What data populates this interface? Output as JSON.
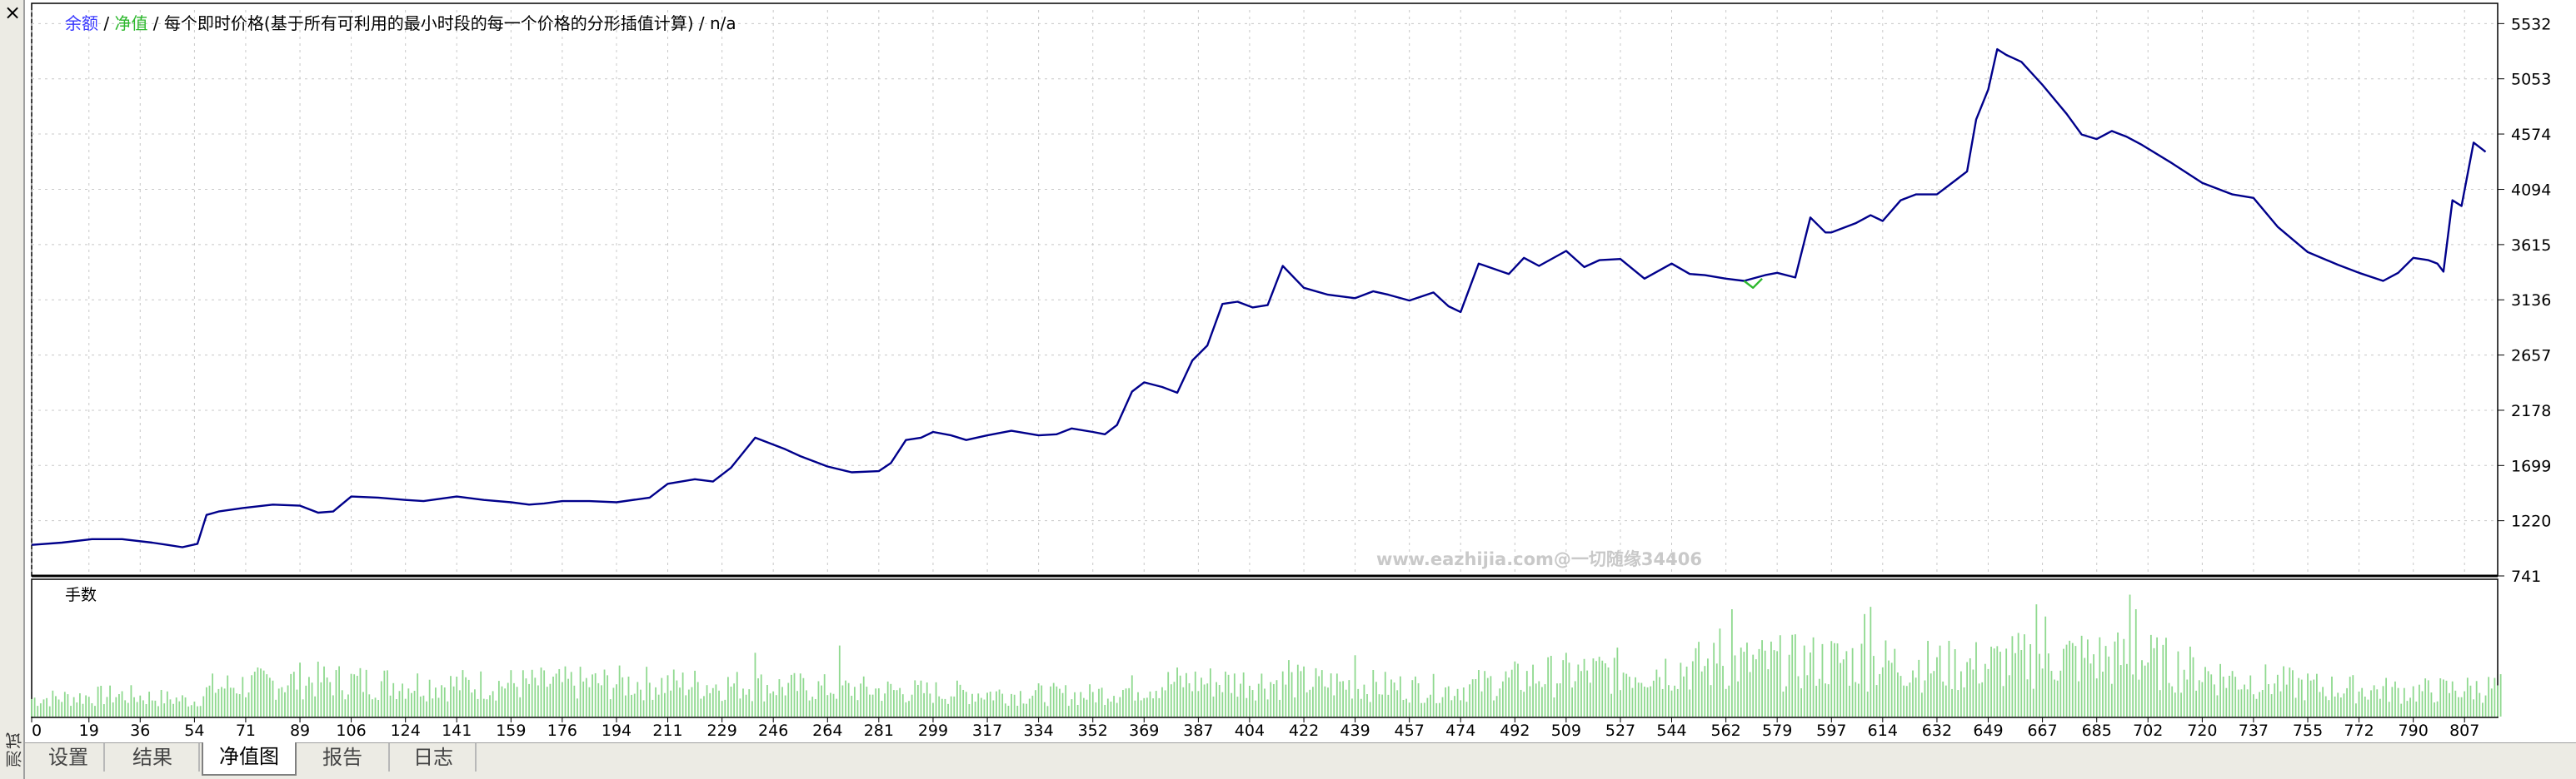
{
  "sidebar": {
    "close_label": "×",
    "label": "测试"
  },
  "legend": {
    "balance": "余额",
    "sep1": " / ",
    "equity": "净值",
    "sep2": " / ",
    "rest": "每个即时价格(基于所有可利用的最小时段的每一个价格的分形插值计算) / n/a"
  },
  "lower_panel_label": "手数",
  "watermark": "www.eazhijia.com@一切随缘34406",
  "tabs": [
    {
      "label": "设置",
      "active": false
    },
    {
      "label": "结果",
      "active": false
    },
    {
      "label": "净值图",
      "active": true
    },
    {
      "label": "报告",
      "active": false
    },
    {
      "label": "日志",
      "active": false
    }
  ],
  "colors": {
    "balance_line": "#00008b",
    "equity_line": "#2db82d",
    "volume_bars": "#8fd98f",
    "grid": "#c8c8c8",
    "axis": "#000000"
  },
  "chart_data": [
    {
      "type": "line",
      "series": [
        {
          "name": "余额",
          "x": [
            0,
            10,
            20,
            30,
            40,
            45,
            50,
            55,
            58,
            62,
            70,
            80,
            89,
            95,
            100,
            106,
            115,
            124,
            130,
            141,
            150,
            159,
            165,
            170,
            176,
            185,
            194,
            205,
            211,
            220,
            226,
            232,
            240,
            250,
            255,
            264,
            272,
            281,
            285,
            290,
            295,
            299,
            305,
            310,
            317,
            325,
            334,
            340,
            345,
            352,
            356,
            360,
            365,
            369,
            375,
            380,
            385,
            390,
            395,
            400,
            405,
            410,
            415,
            422,
            430,
            439,
            445,
            450,
            457,
            465,
            470,
            474,
            480,
            490,
            495,
            500,
            509,
            515,
            520,
            527,
            535,
            544,
            550,
            555,
            562,
            568,
            575,
            579,
            585,
            590,
            595,
            597,
            605,
            610,
            614,
            620,
            625,
            632,
            638,
            642,
            645,
            649,
            652,
            655,
            660,
            667,
            675,
            680,
            685,
            690,
            695,
            700,
            710,
            720,
            730,
            737,
            745,
            755,
            765,
            772,
            780,
            785,
            790,
            795,
            798,
            800,
            803,
            806,
            810,
            814
          ],
          "values": [
            1010,
            1030,
            1060,
            1060,
            1030,
            1010,
            990,
            1020,
            1270,
            1300,
            1330,
            1360,
            1350,
            1290,
            1300,
            1430,
            1420,
            1400,
            1390,
            1430,
            1400,
            1380,
            1360,
            1370,
            1390,
            1390,
            1380,
            1420,
            1540,
            1580,
            1560,
            1680,
            1940,
            1840,
            1780,
            1690,
            1640,
            1650,
            1720,
            1920,
            1940,
            1990,
            1960,
            1920,
            1960,
            2000,
            1960,
            1970,
            2020,
            1990,
            1970,
            2050,
            2340,
            2420,
            2380,
            2330,
            2610,
            2740,
            3100,
            3120,
            3070,
            3090,
            3430,
            3240,
            3180,
            3150,
            3210,
            3180,
            3130,
            3200,
            3080,
            3030,
            3450,
            3360,
            3500,
            3430,
            3560,
            3420,
            3480,
            3490,
            3320,
            3450,
            3360,
            3350,
            3320,
            3300,
            3350,
            3370,
            3330,
            3850,
            3720,
            3720,
            3800,
            3870,
            3820,
            4000,
            4050,
            4050,
            4170,
            4250,
            4700,
            4960,
            5310,
            5260,
            5200,
            5000,
            4750,
            4570,
            4530,
            4600,
            4550,
            4480,
            4320,
            4150,
            4050,
            4020,
            3770,
            3550,
            3440,
            3370,
            3300,
            3370,
            3500,
            3480,
            3450,
            3380,
            4000,
            3950,
            4500,
            4420
          ]
        },
        {
          "name": "净值",
          "x": [
            568,
            571,
            574
          ],
          "values": [
            3300,
            3240,
            3320
          ]
        }
      ],
      "xlim": [
        0,
        818
      ],
      "ylim": [
        741,
        5650
      ],
      "y_ticks": [
        741,
        1220,
        1699,
        2178,
        2657,
        3136,
        3615,
        4094,
        4574,
        5053,
        5532
      ],
      "x_ticks": [
        0,
        19,
        36,
        54,
        71,
        89,
        106,
        124,
        141,
        159,
        176,
        194,
        211,
        229,
        246,
        264,
        281,
        299,
        317,
        334,
        352,
        369,
        387,
        404,
        422,
        439,
        457,
        474,
        492,
        509,
        527,
        544,
        562,
        579,
        597,
        614,
        632,
        649,
        667,
        685,
        702,
        720,
        737,
        755,
        772,
        790,
        807
      ],
      "grid": true
    },
    {
      "type": "bar",
      "title": "手数",
      "x": [
        0,
        819
      ],
      "lot_profile": {
        "x": [
          0,
          30,
          54,
          60,
          90,
          140,
          200,
          240,
          300,
          350,
          380,
          420,
          470,
          500,
          540,
          565,
          600,
          640,
          670,
          700,
          730,
          760,
          790,
          818
        ],
        "values": [
          0.18,
          0.22,
          0.16,
          0.3,
          0.38,
          0.33,
          0.35,
          0.32,
          0.25,
          0.22,
          0.36,
          0.36,
          0.28,
          0.42,
          0.5,
          0.55,
          0.58,
          0.52,
          0.62,
          0.6,
          0.4,
          0.3,
          0.26,
          0.3
        ]
      },
      "peaks": {
        "x": [
          240,
          268,
          417,
          439,
          560,
          564,
          608,
          610,
          665,
          668,
          696,
          698
        ],
        "values": [
          0.52,
          0.58,
          0.46,
          0.5,
          0.72,
          0.88,
          0.84,
          0.9,
          0.92,
          0.82,
          1.0,
          0.88
        ]
      },
      "ylim": [
        0,
        1.1
      ]
    }
  ]
}
